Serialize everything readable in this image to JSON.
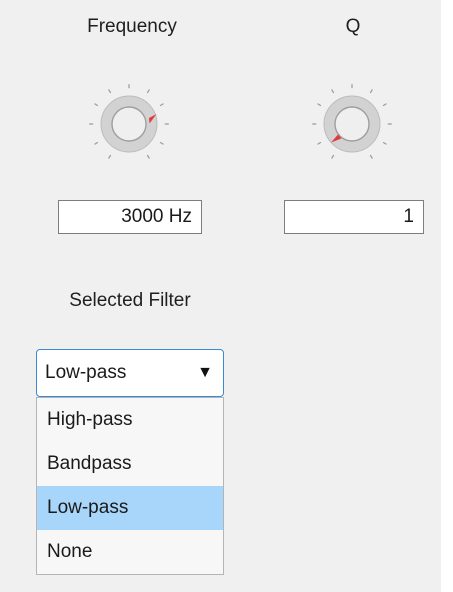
{
  "frequency": {
    "label": "Frequency",
    "value_text": "3000 Hz"
  },
  "q": {
    "label": "Q",
    "value_text": "1"
  },
  "filter": {
    "label": "Selected Filter",
    "selected": "Low-pass",
    "options": [
      "High-pass",
      "Bandpass",
      "Low-pass",
      "None"
    ]
  },
  "colors": {
    "background": "#f0f0f0",
    "indicator": "#e23b3b",
    "selection": "#a8d5fa",
    "focus_border": "#3b8ad8"
  }
}
